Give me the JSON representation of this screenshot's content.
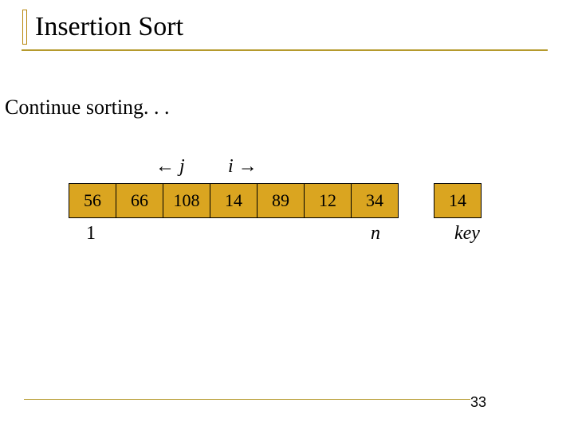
{
  "title": "Insertion Sort",
  "subtitle": "Continue sorting. . .",
  "annotations": {
    "j_left": "← ",
    "j_var": "j",
    "i_var": "i",
    "i_right": " →"
  },
  "array": {
    "cells": [
      "56",
      "66",
      "108",
      "14",
      "89",
      "12",
      "34"
    ],
    "key": "14",
    "index_first": "1",
    "index_last": "n",
    "key_label_text": "key"
  },
  "page_number": "33"
}
